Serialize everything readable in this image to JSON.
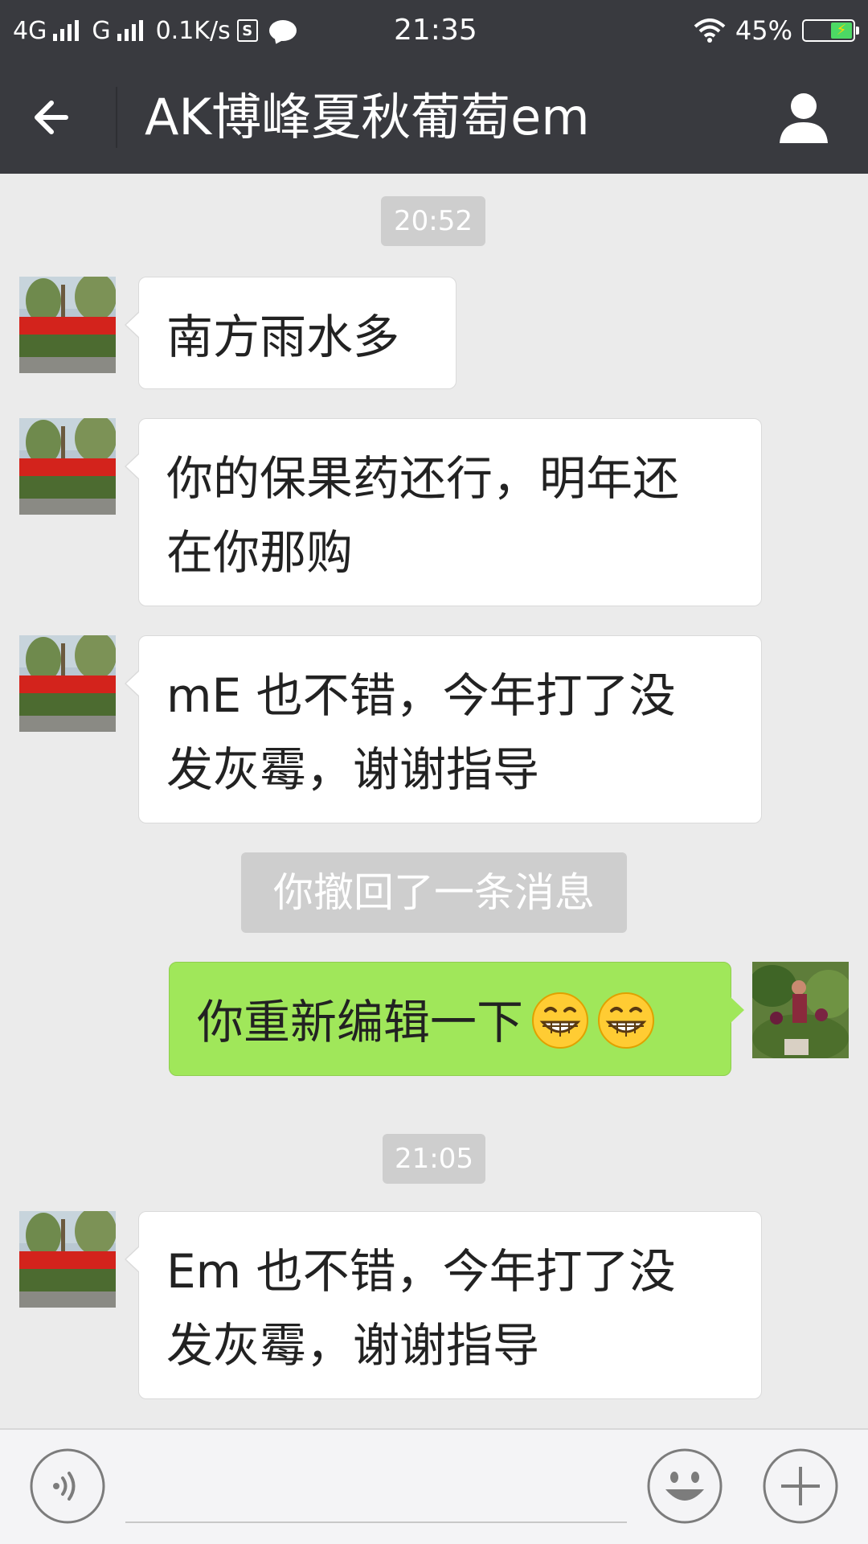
{
  "status_bar": {
    "network1": "4G",
    "network2": "G",
    "speed": "0.1K/s",
    "s_icon_letter": "S",
    "time": "21:35",
    "battery": "45%",
    "battery_level": 0.45
  },
  "header": {
    "title": "AK博峰夏秋葡萄em",
    "back_icon": "back-arrow-icon",
    "profile_icon": "person-icon"
  },
  "messages": {
    "ts1": "20:52",
    "m1": "南方雨水多",
    "m2_l1": "你的保果药还行，明年还",
    "m2_l2": "在你那购",
    "m3_l1": "mE 也不错，今年打了没",
    "m3_l2": "发灰霉，谢谢指导",
    "recall": "你撤回了一条消息",
    "m4": "你重新编辑一下",
    "m4_emoji": "grinning-face-icon",
    "ts2": "21:05",
    "m5_l1": "Em 也不错，今年打了没",
    "m5_l2": "发灰霉，谢谢指导"
  },
  "input_bar": {
    "voice_icon": "voice-icon",
    "emoji_icon": "smiley-icon",
    "plus_icon": "plus-icon"
  },
  "colors": {
    "header_bg": "#393a3f",
    "chat_bg": "#ebebeb",
    "outgoing_bubble": "#a0e75a",
    "incoming_bubble": "#ffffff",
    "timestamp_bg": "#cecece"
  }
}
